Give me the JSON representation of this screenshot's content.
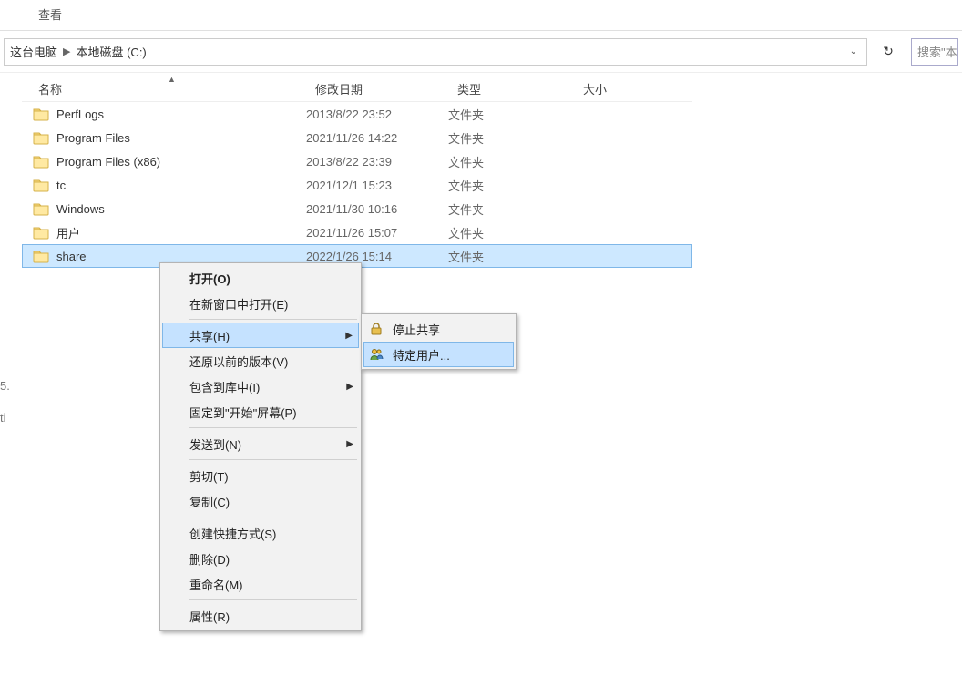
{
  "menubar": {
    "view": "查看"
  },
  "address": {
    "loc0": "这台电脑",
    "loc1": "本地磁盘 (C:)"
  },
  "refresh_icon": "↻",
  "search": {
    "placeholder": "搜索\"本"
  },
  "columns": {
    "name": "名称",
    "date": "修改日期",
    "type": "类型",
    "size": "大小"
  },
  "rows": [
    {
      "name": "PerfLogs",
      "date": "2013/8/22 23:52",
      "type": "文件夹",
      "size": ""
    },
    {
      "name": "Program Files",
      "date": "2021/11/26 14:22",
      "type": "文件夹",
      "size": ""
    },
    {
      "name": "Program Files (x86)",
      "date": "2013/8/22 23:39",
      "type": "文件夹",
      "size": ""
    },
    {
      "name": "tc",
      "date": "2021/12/1 15:23",
      "type": "文件夹",
      "size": ""
    },
    {
      "name": "Windows",
      "date": "2021/11/30 10:16",
      "type": "文件夹",
      "size": ""
    },
    {
      "name": "用户",
      "date": "2021/11/26 15:07",
      "type": "文件夹",
      "size": ""
    },
    {
      "name": "share",
      "date": "2022/1/26 15:14",
      "type": "文件夹",
      "size": ""
    }
  ],
  "gutter": {
    "g1": "5.",
    "g2": "ti"
  },
  "context": {
    "open": "打开(O)",
    "new_win": "在新窗口中打开(E)",
    "share": "共享(H)",
    "restore": "还原以前的版本(V)",
    "include": "包含到库中(I)",
    "pin": "固定到\"开始\"屏幕(P)",
    "sendto": "发送到(N)",
    "cut": "剪切(T)",
    "copy": "复制(C)",
    "shortcut": "创建快捷方式(S)",
    "del": "删除(D)",
    "rename": "重命名(M)",
    "props": "属性(R)"
  },
  "submenu": {
    "stop": "停止共享",
    "users": "特定用户..."
  }
}
